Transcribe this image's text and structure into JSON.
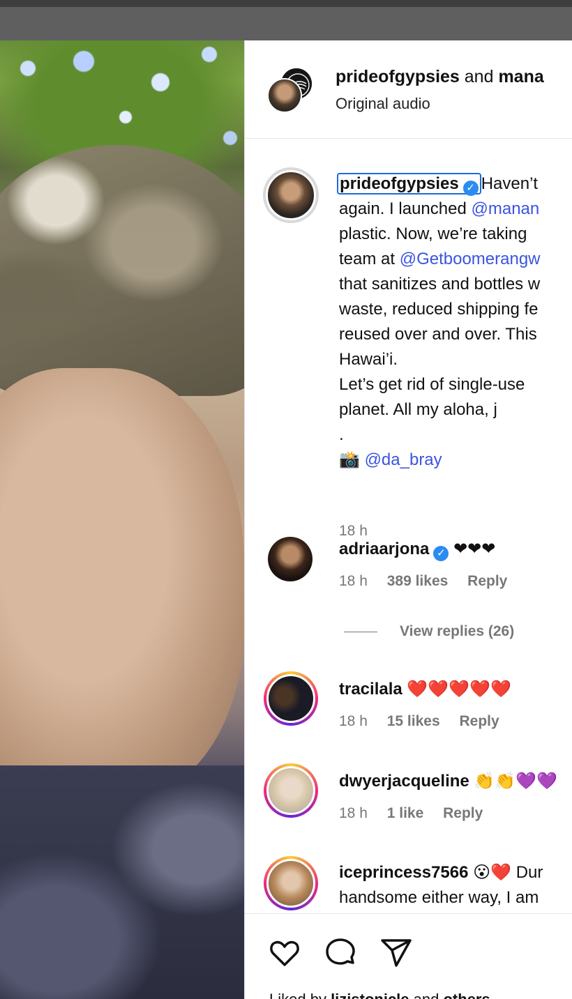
{
  "post": {
    "header_user1": "prideofgypsies",
    "header_and": "and",
    "header_user2": "mana",
    "audio": "Original audio"
  },
  "caption": {
    "username": "prideofgypsies",
    "lines": [
      "Haven’t",
      "again. I launched ",
      "@manan",
      "plastic. Now, we’re taking",
      "team at ",
      "@Getboomerangw",
      "that sanitizes and bottles w",
      "waste, reduced shipping fe",
      "reused over and over. This",
      "Hawai’i.",
      "Let’s get rid of single-use",
      "planet. All my aloha, j",
      ".",
      "📸 ",
      "@da_bray"
    ],
    "time": "18 h"
  },
  "comments": [
    {
      "username": "adriaarjona",
      "text": "❤❤❤",
      "time": "18 h",
      "likes": "389 likes",
      "reply": "Reply",
      "verified": true
    },
    {
      "username": "tracilala",
      "text": "❤️❤️❤️❤️❤️",
      "time": "18 h",
      "likes": "15 likes",
      "reply": "Reply",
      "verified": false
    },
    {
      "username": "dwyerjacqueline",
      "text": "👏👏💜💜",
      "time": "18 h",
      "likes": "1 like",
      "reply": "Reply",
      "verified": false
    },
    {
      "username": "iceprincess7566",
      "text": "😮❤️ Dur",
      "text2": "handsome either way, I am",
      "verified": false
    }
  ],
  "view_replies": "View replies (26)",
  "actions": {
    "like": "heart-icon",
    "comment": "comment-icon",
    "share": "send-icon"
  },
  "liked_by": {
    "prefix": "Liked by ",
    "user": "lizistonicle",
    "middle": " and ",
    "others": "others"
  },
  "colors": {
    "mention": "#3b54e0",
    "verified": "#2b8cf0",
    "focus": "#1a6bdc"
  }
}
